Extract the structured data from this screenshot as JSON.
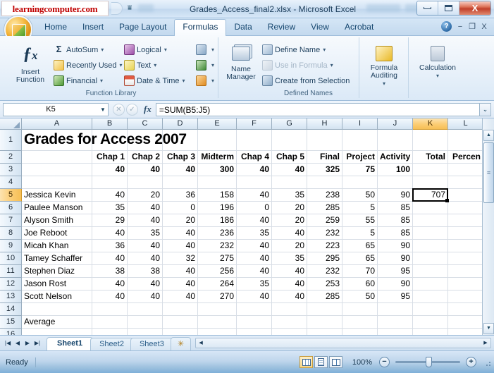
{
  "window": {
    "watermark": "learningcomputer.com",
    "title": "Grades_Access_final2.xlsx - Microsoft Excel",
    "qat_dropdown_icon": "chevron-down-icon",
    "minimize_label": "",
    "maximize_label": "",
    "close_label": "X"
  },
  "ribbon": {
    "office_button": "office-orb",
    "tabs": [
      {
        "label": "Home",
        "active": false
      },
      {
        "label": "Insert",
        "active": false
      },
      {
        "label": "Page Layout",
        "active": false
      },
      {
        "label": "Formulas",
        "active": true
      },
      {
        "label": "Data",
        "active": false
      },
      {
        "label": "Review",
        "active": false
      },
      {
        "label": "View",
        "active": false
      },
      {
        "label": "Acrobat",
        "active": false
      }
    ],
    "help_label": "?",
    "minimize_ribbon": "−",
    "restore_ribbon": "❐",
    "close_doc": "X",
    "groups": [
      {
        "name": "Function Library",
        "title": "Function Library",
        "big_button": {
          "line1": "Insert",
          "line2": "Function",
          "icon": "fx-icon"
        },
        "items": [
          {
            "label": "AutoSum",
            "icon": "sigma-icon",
            "caret": true,
            "disabled": false
          },
          {
            "label": "Recently Used",
            "icon": "recent-icon",
            "caret": true,
            "disabled": false
          },
          {
            "label": "Financial",
            "icon": "financial-icon",
            "caret": true,
            "disabled": false
          },
          {
            "label": "Logical",
            "icon": "logical-icon",
            "caret": true,
            "disabled": false
          },
          {
            "label": "Text",
            "icon": "text-icon",
            "caret": true,
            "disabled": false
          },
          {
            "label": "Date & Time",
            "icon": "date-time-icon",
            "caret": true,
            "disabled": false
          },
          {
            "label": "",
            "icon": "lookup-reference-icon",
            "caret": true,
            "disabled": false
          },
          {
            "label": "",
            "icon": "math-trig-icon",
            "caret": true,
            "disabled": false
          },
          {
            "label": "",
            "icon": "more-functions-icon",
            "caret": true,
            "disabled": false
          }
        ]
      },
      {
        "name": "Defined Names",
        "title": "Defined Names",
        "big_button": {
          "line1": "Name",
          "line2": "Manager",
          "icon": "name-manager-icon"
        },
        "items": [
          {
            "label": "Define Name",
            "icon": "define-name-icon",
            "caret": true,
            "disabled": false
          },
          {
            "label": "Use in Formula",
            "icon": "use-in-formula-icon",
            "caret": true,
            "disabled": true
          },
          {
            "label": "Create from Selection",
            "icon": "create-from-selection-icon",
            "caret": false,
            "disabled": false
          }
        ]
      },
      {
        "name": "Formula Auditing",
        "title": "",
        "big_button": {
          "line1": "Formula",
          "line2": "Auditing",
          "icon": "formula-auditing-icon",
          "caret": true
        },
        "items": []
      },
      {
        "name": "Calculation",
        "title": "",
        "big_button": {
          "line1": "Calculation",
          "line2": "",
          "icon": "calculation-icon",
          "caret": true
        },
        "items": []
      }
    ]
  },
  "formula_bar": {
    "name_box_value": "K5",
    "name_box_dropdown": "chevron-down-icon",
    "cancel_icon": "cancel-icon",
    "enter_icon": "enter-icon",
    "fx_label": "fx",
    "formula_value": "=SUM(B5:J5)",
    "expand_icon": "expand-formula-bar-icon"
  },
  "grid": {
    "columns": [
      "A",
      "B",
      "C",
      "D",
      "E",
      "F",
      "G",
      "H",
      "I",
      "J",
      "K",
      "L"
    ],
    "selected_column": "K",
    "rows": [
      "1",
      "2",
      "3",
      "4",
      "5",
      "6",
      "7",
      "8",
      "9",
      "10",
      "11",
      "12",
      "13",
      "14",
      "15",
      "16"
    ],
    "selected_row": "5",
    "selected_cell": "K5",
    "selected_cell_value": "707",
    "title_cell": "Grades for Access 2007",
    "headers": [
      "",
      "Chap 1",
      "Chap 2",
      "Chap 3",
      "Midterm",
      "Chap 4",
      "Chap 5",
      "Final",
      "Project",
      "Activity",
      "Total",
      "Percen"
    ],
    "max_points": [
      "",
      "40",
      "40",
      "40",
      "300",
      "40",
      "40",
      "325",
      "75",
      "100",
      "",
      ""
    ],
    "students": [
      {
        "name": "Jessica Kevin",
        "scores": [
          "40",
          "20",
          "36",
          "158",
          "40",
          "35",
          "238",
          "50",
          "90"
        ],
        "total": "707"
      },
      {
        "name": "Paulee Manson",
        "scores": [
          "35",
          "40",
          "0",
          "196",
          "0",
          "20",
          "285",
          "5",
          "85"
        ],
        "total": ""
      },
      {
        "name": "Alyson Smith",
        "scores": [
          "29",
          "40",
          "20",
          "186",
          "40",
          "20",
          "259",
          "55",
          "85"
        ],
        "total": ""
      },
      {
        "name": "Joe Reboot",
        "scores": [
          "40",
          "35",
          "40",
          "236",
          "35",
          "40",
          "232",
          "5",
          "85"
        ],
        "total": ""
      },
      {
        "name": "Micah Khan",
        "scores": [
          "36",
          "40",
          "40",
          "232",
          "40",
          "20",
          "223",
          "65",
          "90"
        ],
        "total": ""
      },
      {
        "name": "Tamey Schaffer",
        "scores": [
          "40",
          "40",
          "32",
          "275",
          "40",
          "35",
          "295",
          "65",
          "90"
        ],
        "total": ""
      },
      {
        "name": "Stephen Diaz",
        "scores": [
          "38",
          "38",
          "40",
          "256",
          "40",
          "40",
          "232",
          "70",
          "95"
        ],
        "total": ""
      },
      {
        "name": "Jason Rost",
        "scores": [
          "40",
          "40",
          "40",
          "264",
          "35",
          "40",
          "253",
          "60",
          "90"
        ],
        "total": ""
      },
      {
        "name": "Scott Nelson",
        "scores": [
          "40",
          "40",
          "40",
          "270",
          "40",
          "40",
          "285",
          "50",
          "95"
        ],
        "total": ""
      }
    ],
    "average_label": "Average"
  },
  "sheet_bar": {
    "nav_first": "|◀",
    "nav_prev": "◀",
    "nav_next": "▶",
    "nav_last": "▶|",
    "tabs": [
      {
        "label": "Sheet1",
        "active": true
      },
      {
        "label": "Sheet2",
        "active": false
      },
      {
        "label": "Sheet3",
        "active": false
      }
    ],
    "new_sheet_icon": "insert-worksheet-icon"
  },
  "status_bar": {
    "status": "Ready",
    "view_normal": "normal-view-icon",
    "view_page_layout": "page-layout-view-icon",
    "view_page_break": "page-break-preview-icon",
    "zoom_level": "100%",
    "zoom_out": "−",
    "zoom_in": "+"
  },
  "colors": {
    "accent": "#f7bf56",
    "ribbon_bg": "#e8f1fa",
    "selection_border": "#000000",
    "title_text": "#1c3d5a"
  }
}
